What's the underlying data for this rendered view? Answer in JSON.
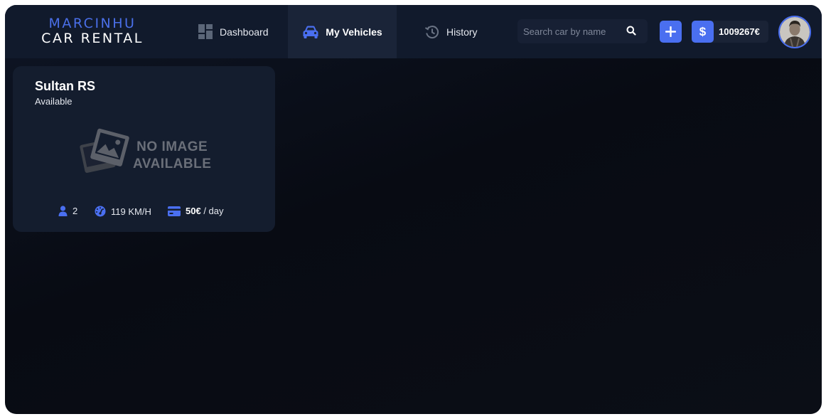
{
  "brand": {
    "line1": "MARCINHU",
    "line2": "CAR RENTAL"
  },
  "nav": [
    {
      "label": "Dashboard",
      "icon": "dashboard-icon",
      "active": false
    },
    {
      "label": "My Vehicles",
      "icon": "car-icon",
      "active": true
    },
    {
      "label": "History",
      "icon": "history-icon",
      "active": false
    }
  ],
  "search": {
    "placeholder": "Search car by name",
    "value": ""
  },
  "add_button": {
    "icon": "plus-icon"
  },
  "balance": {
    "symbol": "$",
    "amount": "1009267€"
  },
  "user": {
    "avatar": "user-avatar"
  },
  "vehicles": [
    {
      "name": "Sultan RS",
      "status": "Available",
      "image_placeholder": [
        "NO IMAGE",
        "AVAILABLE"
      ],
      "seats": "2",
      "top_speed": "119 KM/H",
      "price": "50€",
      "price_unit": " / day"
    }
  ],
  "colors": {
    "accent": "#4a6ff0",
    "header_bg": "#111a2c",
    "card_bg": "#141d2e",
    "brand_blue": "#4a6fe8"
  }
}
